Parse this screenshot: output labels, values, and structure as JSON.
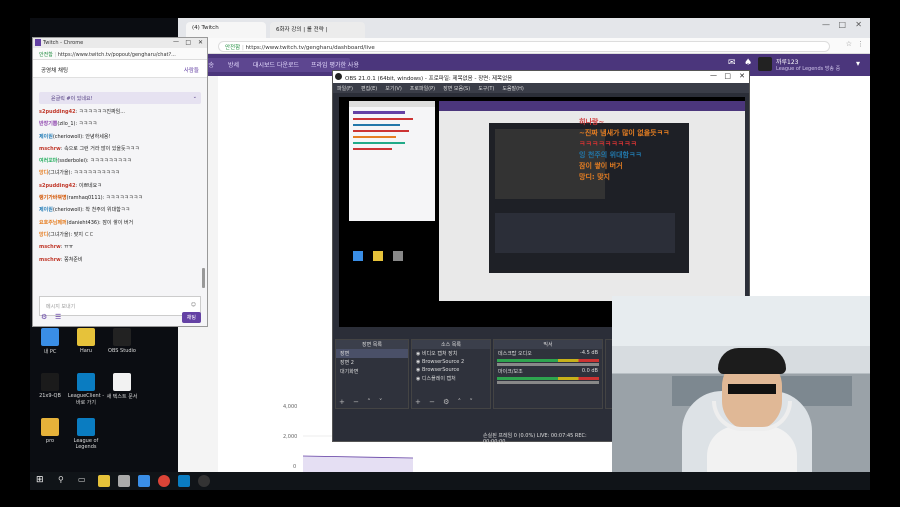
{
  "desktop": {
    "icons": [
      {
        "label": "내 PC",
        "color": "#3a8ee6"
      },
      {
        "label": "Haru",
        "color": "#e6c23a"
      },
      {
        "label": "OBS Studio",
        "color": "#222222"
      },
      {
        "label": "21x9-QB",
        "color": "#1b1b1b"
      },
      {
        "label": "LeagueClient - 바로 가기",
        "color": "#0a7cc1"
      },
      {
        "label": "새 텍스트 문서",
        "color": "#f2f2f2"
      },
      {
        "label": "pro",
        "color": "#e6b23a"
      },
      {
        "label": "League of Legends",
        "color": "#0a7cc1"
      }
    ]
  },
  "browser_main": {
    "tabs": [
      "(4) Twitch",
      "6화자 강의 | 롤 전략 |"
    ],
    "url": "https://www.twitch.tv/gengharu/dashboard/live",
    "secure_label": "안전함",
    "nav": [
      "방송",
      "방세",
      "대시보드 다운로드",
      "프라임 평가한 사용"
    ],
    "user_name": "까루123",
    "user_game": "League of Legends 방송 중",
    "chart_ticks": [
      "4,000",
      "2,000",
      "0"
    ]
  },
  "chat": {
    "title": "Twitch - Chrome",
    "secure_label": "안전함",
    "url": "https://www.twitch.tv/popout/gengharu/chat?...",
    "header": "공영채 채팅",
    "header_right": "사람들",
    "notice": "윤글릭 #이 있네요!",
    "messages": [
      {
        "user": "s2pudding42",
        "text": ": ㅋㅋㅋㅋㅋㅋ진짜임...",
        "color": "#c0392b"
      },
      {
        "user": "반장기쁨",
        "text": "(zilo_1): ㅋㅋㅋㅋ",
        "color": "#8e44ad"
      },
      {
        "user": "제이원",
        "text": "(cheriowoll): 안녕하세용!",
        "color": "#2980b9"
      },
      {
        "user": "mschrw",
        "text": ": 속으로 그런 거라 많이 있을듯ㅋㅋㅋ",
        "color": "#c0392b"
      },
      {
        "user": "여러꼬마",
        "text": "(ssderbolei): ㅋㅋㅋㅋㅋㅋㅋㅋㅋ",
        "color": "#27ae60"
      },
      {
        "user": "망디",
        "text": "(그녀가을): ㅋㅋㅋㅋㅋㅋㅋㅋㅋㅋ",
        "color": "#e67e22"
      },
      {
        "user": "s2pudding42",
        "text": ": 이쁘네요ㅋ",
        "color": "#c0392b"
      },
      {
        "user": "랭기가바꿔명",
        "text": "(ramhaq0111): ㅋㅋㅋㅋㅋㅋㅋㅋ",
        "color": "#d35400"
      },
      {
        "user": "제이원",
        "text": "(cheriowoll): 착 천주의 위대함ㅋㅋ",
        "color": "#2980b9"
      },
      {
        "user": "요호주님페퍼",
        "text": "(danieht436): 잠이 쌓이 버거",
        "color": "#e67e22"
      },
      {
        "user": "망디",
        "text": "(그녀가을): 맞지 ㄷㄷ",
        "color": "#e67e22"
      },
      {
        "user": "mschrw",
        "text": ": ㅠㅠ",
        "color": "#c0392b"
      },
      {
        "user": "mschrw",
        "text": ": 쫑쳐준비",
        "color": "#c0392b"
      }
    ],
    "input_placeholder": "메시지 보내기",
    "send_button": "채팅"
  },
  "obs": {
    "title": "OBS 21.0.1 (64bit, windows) - 프로파일: 제목없음 - 장면: 제목없음",
    "menu": [
      "파일(F)",
      "편집(E)",
      "보기(V)",
      "프로파일(P)",
      "장면 모음(S)",
      "도구(T)",
      "도움말(H)"
    ],
    "scenes_title": "장면 목록",
    "scenes": [
      "장면",
      "장면 2",
      "대기화면"
    ],
    "sources_title": "소스 목록",
    "sources": [
      "비디오 캡처 장치",
      "BrowserSource 2",
      "BrowserSource",
      "디스플레이 캡처"
    ],
    "mixer_title": "믹서",
    "mixer": [
      {
        "name": "데스크탑 오디오",
        "db": "-4.5 dB"
      },
      {
        "name": "마이크/보조",
        "db": "0.0 dB"
      }
    ],
    "status": "손실된 프레임 0 (0.0%)    LIVE: 00:07:45    REC: 00:00:00"
  },
  "overlay_text": [
    "히나랑~",
    "~진짜 냄새가 많이 없을듯ㅋㅋ",
    "ㅋㅋㅋㅋㅋㅋㅋㅋㅋ",
    "잉 천주의 위대함ㅋㅋ",
    "잠이 쌓이 버거",
    "망디: 맞지"
  ]
}
